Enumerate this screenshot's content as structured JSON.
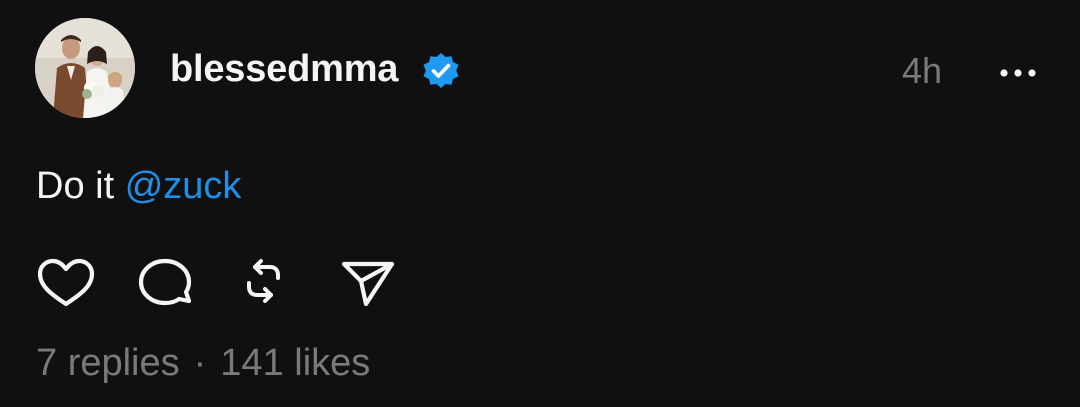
{
  "post": {
    "username": "blessedmma",
    "timestamp": "4h",
    "text_prefix": "Do it ",
    "mention": "@zuck",
    "stats": {
      "replies": "7 replies",
      "separator": "·",
      "likes": "141 likes"
    }
  },
  "icons": {
    "verified": "verified-badge-icon",
    "more": "more-options-icon",
    "like": "heart-icon",
    "reply": "comment-bubble-icon",
    "repost": "repost-icon",
    "share": "send-icon"
  },
  "colors": {
    "background": "#101010",
    "primary_text": "#f3f5f7",
    "secondary_text": "#7a7a7a",
    "mention": "#1e90e8",
    "verified": "#1d9bf0"
  }
}
